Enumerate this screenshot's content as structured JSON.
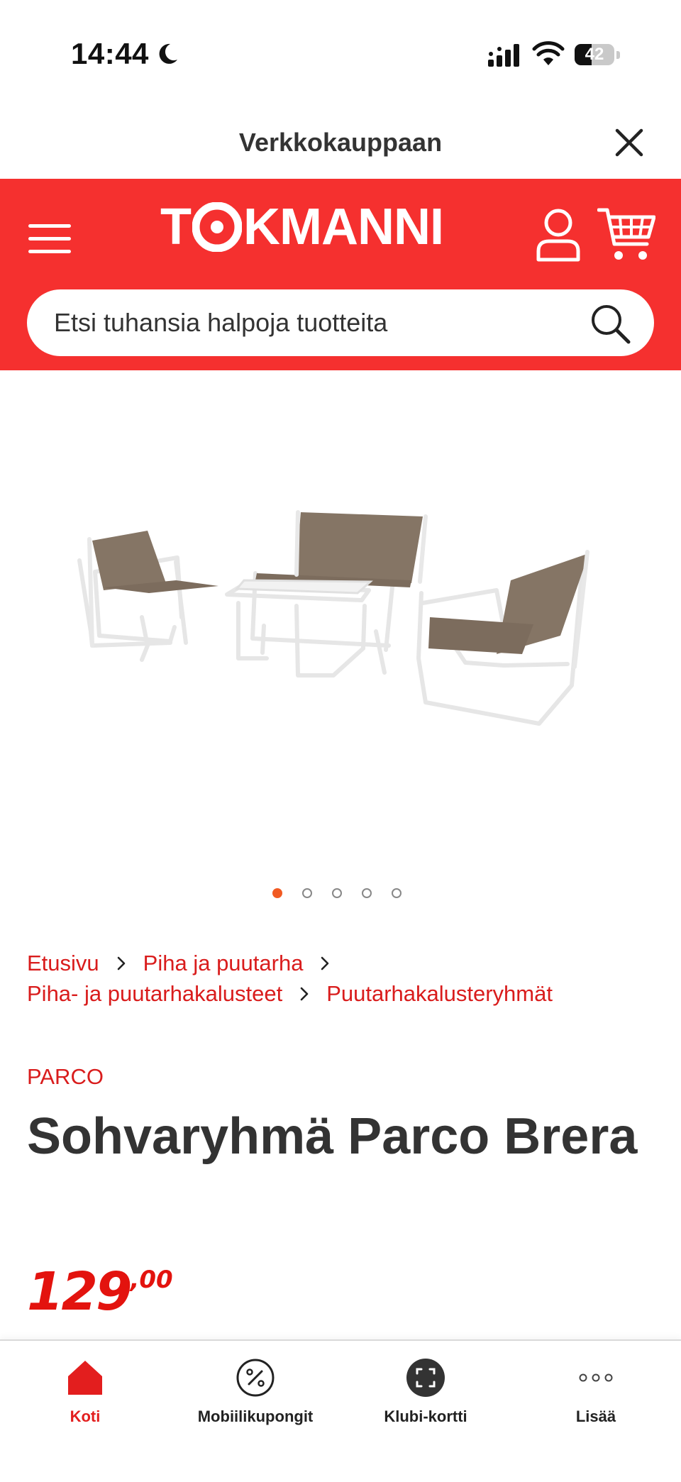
{
  "status_bar": {
    "time": "14:44",
    "battery": "42",
    "battery_level": 0.42
  },
  "sheet": {
    "title": "Verkkokauppaan"
  },
  "header": {
    "logo_text_before": "T",
    "logo_text_after": "KMANNI",
    "brand_color": "#f5302f",
    "search": {
      "placeholder": "Etsi tuhansia halpoja tuotteita"
    }
  },
  "carousel": {
    "total": 5,
    "active_index": 1,
    "active_color": "#f15a22"
  },
  "breadcrumb": {
    "items": [
      "Etusivu",
      "Piha ja puutarha",
      "Piha- ja puutarhakalusteet",
      "Puutarhakalusteryhmät"
    ]
  },
  "product": {
    "brand": "PARCO",
    "title": "Sohvaryhmä Parco Brera",
    "price_integer": "129",
    "price_decimal": ",00",
    "price_color": "#e3130e"
  },
  "bottom_nav": {
    "items": [
      {
        "label": "Koti",
        "icon": "home-icon",
        "active": true
      },
      {
        "label": "Mobiilikupongit",
        "icon": "coupon-icon",
        "active": false
      },
      {
        "label": "Klubi-kortti",
        "icon": "club-card-icon",
        "active": false
      },
      {
        "label": "Lisää",
        "icon": "more-icon",
        "active": false
      }
    ]
  }
}
